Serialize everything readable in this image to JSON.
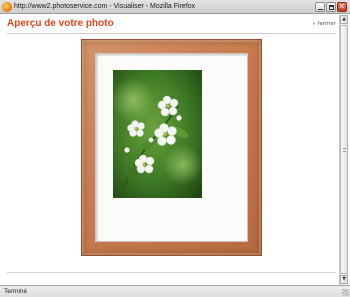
{
  "window": {
    "title": "http://www2.photoservice.com - Visualiser - Mozilla Firefox"
  },
  "page": {
    "title": "Aperçu de votre photo",
    "close_link": "» fermer"
  },
  "statusbar": {
    "text": "Terminé"
  },
  "icons": {
    "app": "firefox-icon",
    "minimize": "minimize-icon",
    "maximize": "maximize-icon",
    "close": "close-icon"
  },
  "colors": {
    "title_accent": "#e2451a",
    "frame_wood": "#c77b4e",
    "close_button": "#c0391b"
  }
}
